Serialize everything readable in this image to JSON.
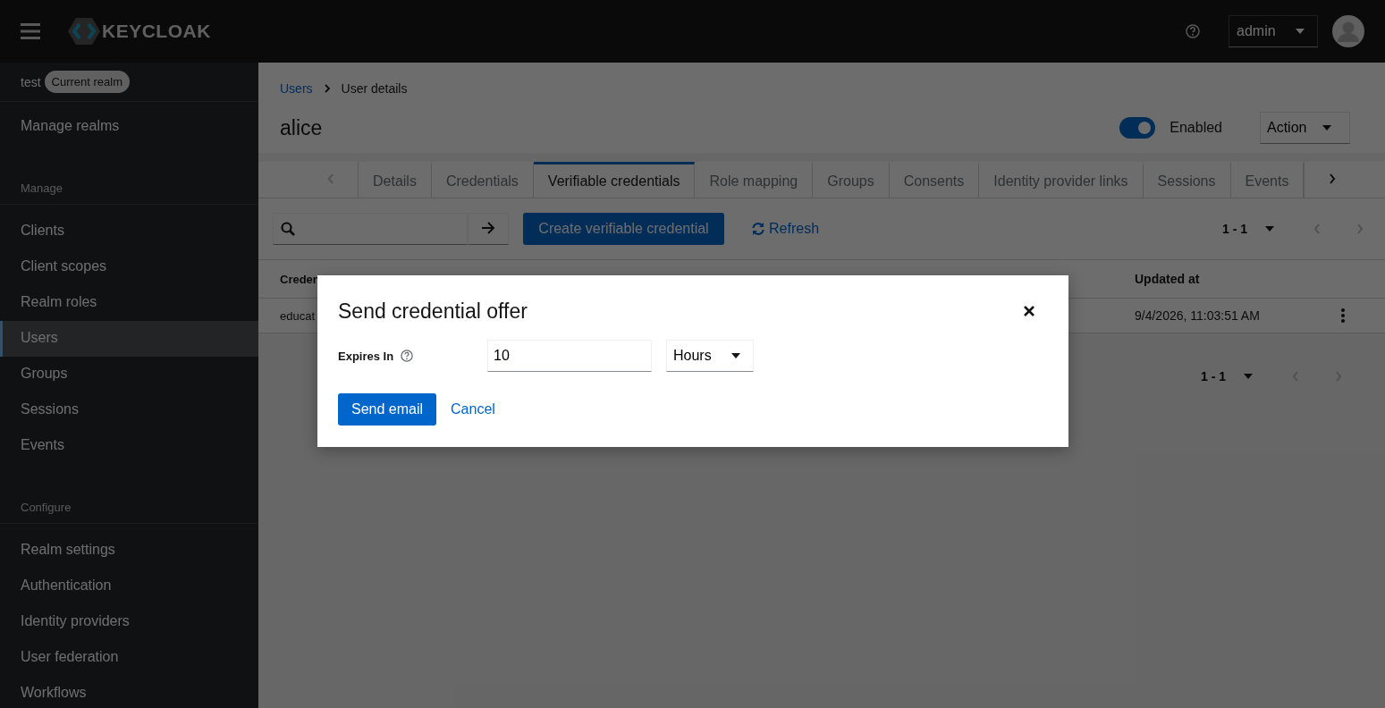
{
  "header": {
    "logo_text": "KEYCLOAK",
    "user": "admin"
  },
  "sidebar": {
    "realm": {
      "name": "test",
      "badge": "Current realm"
    },
    "manage_realms": "Manage realms",
    "sections": [
      {
        "title": "Manage",
        "items": [
          {
            "label": "Clients",
            "selected": false
          },
          {
            "label": "Client scopes",
            "selected": false
          },
          {
            "label": "Realm roles",
            "selected": false
          },
          {
            "label": "Users",
            "selected": true
          },
          {
            "label": "Groups",
            "selected": false
          },
          {
            "label": "Sessions",
            "selected": false
          },
          {
            "label": "Events",
            "selected": false
          }
        ]
      },
      {
        "title": "Configure",
        "items": [
          {
            "label": "Realm settings",
            "selected": false
          },
          {
            "label": "Authentication",
            "selected": false
          },
          {
            "label": "Identity providers",
            "selected": false
          },
          {
            "label": "User federation",
            "selected": false
          },
          {
            "label": "Workflows",
            "selected": false
          }
        ]
      }
    ]
  },
  "breadcrumb": [
    {
      "label": "Users",
      "kind": "link"
    },
    {
      "label": "User details",
      "kind": "current"
    }
  ],
  "title": "alice",
  "enabled": {
    "label": "Enabled",
    "on": true
  },
  "action": "Action",
  "tabs": [
    {
      "label": "Details",
      "selected": false
    },
    {
      "label": "Credentials",
      "selected": false
    },
    {
      "label": "Verifiable credentials",
      "selected": true
    },
    {
      "label": "Role mapping",
      "selected": false
    },
    {
      "label": "Groups",
      "selected": false
    },
    {
      "label": "Consents",
      "selected": false
    },
    {
      "label": "Identity provider links",
      "selected": false
    },
    {
      "label": "Sessions",
      "selected": false
    },
    {
      "label": "Events",
      "selected": false
    }
  ],
  "toolbar": {
    "create_button": "Create verifiable credential",
    "refresh": "Refresh",
    "pagination": "1 - 1"
  },
  "table": {
    "columns": [
      "Creden",
      "Updated at"
    ],
    "rows": [
      {
        "cells": [
          "educat",
          "9/4/2026, 11:03:51 AM"
        ]
      }
    ]
  },
  "bottom_pagination": "1 - 1",
  "modal": {
    "title": "Send credential offer",
    "field_label": "Expires In",
    "value": "10",
    "unit": "Hours",
    "primary": "Send email",
    "secondary": "Cancel"
  }
}
